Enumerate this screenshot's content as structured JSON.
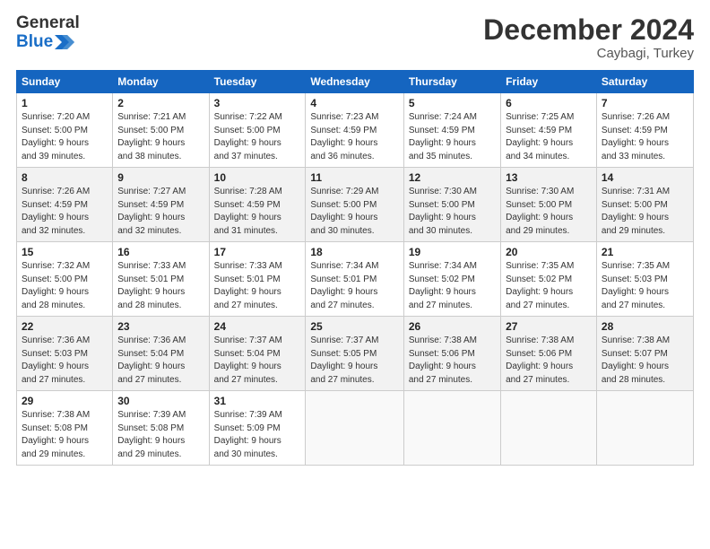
{
  "header": {
    "logo_general": "General",
    "logo_blue": "Blue",
    "month_title": "December 2024",
    "location": "Caybagi, Turkey"
  },
  "weekdays": [
    "Sunday",
    "Monday",
    "Tuesday",
    "Wednesday",
    "Thursday",
    "Friday",
    "Saturday"
  ],
  "weeks": [
    [
      {
        "day": "1",
        "info": "Sunrise: 7:20 AM\nSunset: 5:00 PM\nDaylight: 9 hours\nand 39 minutes."
      },
      {
        "day": "2",
        "info": "Sunrise: 7:21 AM\nSunset: 5:00 PM\nDaylight: 9 hours\nand 38 minutes."
      },
      {
        "day": "3",
        "info": "Sunrise: 7:22 AM\nSunset: 5:00 PM\nDaylight: 9 hours\nand 37 minutes."
      },
      {
        "day": "4",
        "info": "Sunrise: 7:23 AM\nSunset: 4:59 PM\nDaylight: 9 hours\nand 36 minutes."
      },
      {
        "day": "5",
        "info": "Sunrise: 7:24 AM\nSunset: 4:59 PM\nDaylight: 9 hours\nand 35 minutes."
      },
      {
        "day": "6",
        "info": "Sunrise: 7:25 AM\nSunset: 4:59 PM\nDaylight: 9 hours\nand 34 minutes."
      },
      {
        "day": "7",
        "info": "Sunrise: 7:26 AM\nSunset: 4:59 PM\nDaylight: 9 hours\nand 33 minutes."
      }
    ],
    [
      {
        "day": "8",
        "info": "Sunrise: 7:26 AM\nSunset: 4:59 PM\nDaylight: 9 hours\nand 32 minutes."
      },
      {
        "day": "9",
        "info": "Sunrise: 7:27 AM\nSunset: 4:59 PM\nDaylight: 9 hours\nand 32 minutes."
      },
      {
        "day": "10",
        "info": "Sunrise: 7:28 AM\nSunset: 4:59 PM\nDaylight: 9 hours\nand 31 minutes."
      },
      {
        "day": "11",
        "info": "Sunrise: 7:29 AM\nSunset: 5:00 PM\nDaylight: 9 hours\nand 30 minutes."
      },
      {
        "day": "12",
        "info": "Sunrise: 7:30 AM\nSunset: 5:00 PM\nDaylight: 9 hours\nand 30 minutes."
      },
      {
        "day": "13",
        "info": "Sunrise: 7:30 AM\nSunset: 5:00 PM\nDaylight: 9 hours\nand 29 minutes."
      },
      {
        "day": "14",
        "info": "Sunrise: 7:31 AM\nSunset: 5:00 PM\nDaylight: 9 hours\nand 29 minutes."
      }
    ],
    [
      {
        "day": "15",
        "info": "Sunrise: 7:32 AM\nSunset: 5:00 PM\nDaylight: 9 hours\nand 28 minutes."
      },
      {
        "day": "16",
        "info": "Sunrise: 7:33 AM\nSunset: 5:01 PM\nDaylight: 9 hours\nand 28 minutes."
      },
      {
        "day": "17",
        "info": "Sunrise: 7:33 AM\nSunset: 5:01 PM\nDaylight: 9 hours\nand 27 minutes."
      },
      {
        "day": "18",
        "info": "Sunrise: 7:34 AM\nSunset: 5:01 PM\nDaylight: 9 hours\nand 27 minutes."
      },
      {
        "day": "19",
        "info": "Sunrise: 7:34 AM\nSunset: 5:02 PM\nDaylight: 9 hours\nand 27 minutes."
      },
      {
        "day": "20",
        "info": "Sunrise: 7:35 AM\nSunset: 5:02 PM\nDaylight: 9 hours\nand 27 minutes."
      },
      {
        "day": "21",
        "info": "Sunrise: 7:35 AM\nSunset: 5:03 PM\nDaylight: 9 hours\nand 27 minutes."
      }
    ],
    [
      {
        "day": "22",
        "info": "Sunrise: 7:36 AM\nSunset: 5:03 PM\nDaylight: 9 hours\nand 27 minutes."
      },
      {
        "day": "23",
        "info": "Sunrise: 7:36 AM\nSunset: 5:04 PM\nDaylight: 9 hours\nand 27 minutes."
      },
      {
        "day": "24",
        "info": "Sunrise: 7:37 AM\nSunset: 5:04 PM\nDaylight: 9 hours\nand 27 minutes."
      },
      {
        "day": "25",
        "info": "Sunrise: 7:37 AM\nSunset: 5:05 PM\nDaylight: 9 hours\nand 27 minutes."
      },
      {
        "day": "26",
        "info": "Sunrise: 7:38 AM\nSunset: 5:06 PM\nDaylight: 9 hours\nand 27 minutes."
      },
      {
        "day": "27",
        "info": "Sunrise: 7:38 AM\nSunset: 5:06 PM\nDaylight: 9 hours\nand 27 minutes."
      },
      {
        "day": "28",
        "info": "Sunrise: 7:38 AM\nSunset: 5:07 PM\nDaylight: 9 hours\nand 28 minutes."
      }
    ],
    [
      {
        "day": "29",
        "info": "Sunrise: 7:38 AM\nSunset: 5:08 PM\nDaylight: 9 hours\nand 29 minutes."
      },
      {
        "day": "30",
        "info": "Sunrise: 7:39 AM\nSunset: 5:08 PM\nDaylight: 9 hours\nand 29 minutes."
      },
      {
        "day": "31",
        "info": "Sunrise: 7:39 AM\nSunset: 5:09 PM\nDaylight: 9 hours\nand 30 minutes."
      },
      {
        "day": "",
        "info": ""
      },
      {
        "day": "",
        "info": ""
      },
      {
        "day": "",
        "info": ""
      },
      {
        "day": "",
        "info": ""
      }
    ]
  ]
}
